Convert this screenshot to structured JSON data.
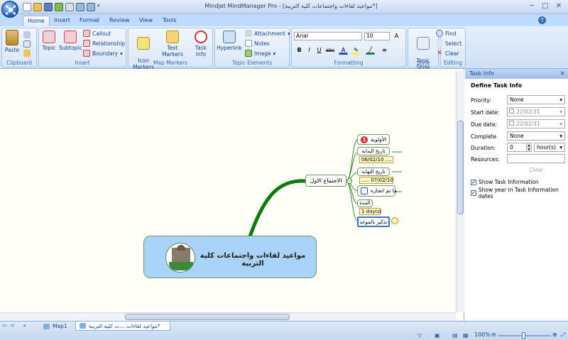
{
  "window": {
    "title": "Mindjet MindManager Pro - [مواعيد لقاءات واجتماعات كلية التربية*]",
    "minimize": "─",
    "maximize": "□",
    "close": "✕"
  },
  "tabs": [
    {
      "label": "Home",
      "active": true
    },
    {
      "label": "Insert"
    },
    {
      "label": "Format"
    },
    {
      "label": "Review"
    },
    {
      "label": "View"
    },
    {
      "label": "Tools"
    }
  ],
  "ribbon": {
    "clipboard": {
      "label": "Clipboard",
      "paste": "Paste"
    },
    "insert": {
      "label": "Insert",
      "topic": "Topic",
      "subtopic": "Subtopic",
      "callout": "Callout",
      "relationship": "Relationship",
      "boundary": "Boundary"
    },
    "map_markers": {
      "label": "Map Markers",
      "icon_markers": "Icon\nMarkers",
      "text_markers": "Text Markers",
      "task_info": "Task Info"
    },
    "topic_elements": {
      "label": "Topic Elements",
      "hyperlink": "Hyperlink",
      "attachment": "Attachment",
      "notes": "Notes",
      "image": "Image"
    },
    "formatting": {
      "label": "Formatting",
      "font": "Arial",
      "size": "10",
      "bold": "B",
      "italic": "I",
      "underline": "U",
      "strike": "abc",
      "font_color": "A"
    },
    "style": {
      "label": "Style",
      "topic_style": "Topic\nStyle"
    },
    "editing": {
      "label": "Editing",
      "find": "Find",
      "select": "Select",
      "clear": "Clear"
    }
  },
  "map": {
    "central_topic": "مواعيد لقاءات واجتماعات كلية التربية",
    "main_topic": "الاجتماع الاول",
    "sub_topics": [
      {
        "label": "الأولوية",
        "badge": "1"
      },
      {
        "label": "تاريخ البداية",
        "value": "06/02/10 ...."
      },
      {
        "label": "تاريخ النهاية",
        "value": "..... 07/02/10"
      },
      {
        "label": "ما تم انجازه"
      },
      {
        "label": "المدة",
        "value": "1 day(s)"
      },
      {
        "label": "تذكير بالموعد"
      }
    ],
    "colors": {
      "branch": "#0e7a0e",
      "central_fill": "#a9d4f7",
      "central_border": "#6e9a6e"
    }
  },
  "task_pane": {
    "header": "Task Info",
    "close": "✕",
    "section": "Define Task Info",
    "priority_label": "Priority:",
    "priority_value": "None",
    "start_label": "Start date:",
    "start_value": "22/02/31",
    "due_label": "Due date:",
    "due_value": "22/02/31",
    "complete_label": "Complete",
    "complete_value": "None",
    "duration_label": "Duration:",
    "duration_value": "0",
    "duration_unit": "hour(s)",
    "resources_label": "Resources:",
    "resources_value": "",
    "clear": "Clear",
    "show_task_info": "Show Task Information",
    "show_year": "Show year in Task Information dates"
  },
  "status": {
    "map_tab": "Map1",
    "doc_tab": "مواعيد لقاءات ...ت كلية التربية*",
    "zoom": "100%"
  }
}
